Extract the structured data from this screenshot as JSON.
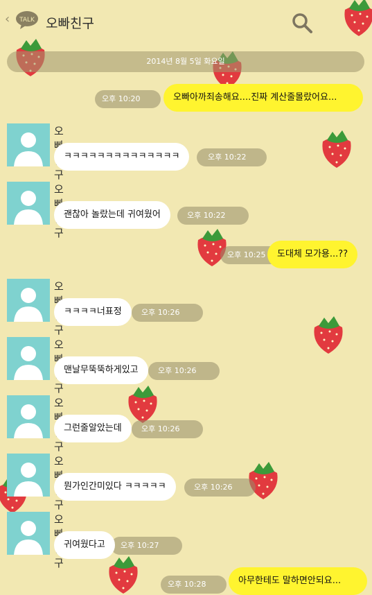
{
  "header": {
    "back_label": "‹",
    "logo_text": "TALK",
    "title": "오빠친구",
    "search_icon": "search-icon",
    "menu_icon": "more-icon"
  },
  "date_divider": "2014년 8월 5일 화요일",
  "messages": [
    {
      "dir": "out",
      "text": "오빠아까죄송해요....진짜 계산줄몰랐어요...",
      "time": "오후 10:20"
    },
    {
      "dir": "in",
      "sender": "오빠친구",
      "text": "ㅋㅋㅋㅋㅋㅋㅋㅋㅋㅋㅋㅋㅋㅋ",
      "time": "오후 10:22"
    },
    {
      "dir": "in",
      "sender": "오빠친구",
      "text": "괜찮아 놀랐는데 귀여웠어",
      "time": "오후 10:22"
    },
    {
      "dir": "out",
      "text": "도대체 모가용...??",
      "time": "오후 10:25"
    },
    {
      "dir": "in",
      "sender": "오빠친구",
      "text": "ㅋㅋㅋㅋ너표정",
      "time": "오후 10:26"
    },
    {
      "dir": "in",
      "sender": "오빠친구",
      "text": "맨날무뚝뚝하게있고",
      "time": "오후 10:26"
    },
    {
      "dir": "in",
      "sender": "오빠친구",
      "text": "그런줄알았는데",
      "time": "오후 10:26"
    },
    {
      "dir": "in",
      "sender": "오빠친구",
      "text": "뭔가인간미있다 ㅋㅋㅋㅋㅋ",
      "time": "오후 10:26"
    },
    {
      "dir": "in",
      "sender": "오빠친구",
      "text": "귀여웠다고",
      "time": "오후 10:27"
    },
    {
      "dir": "out",
      "text": "아무한테도 말하면안되요...",
      "time": "오후 10:28"
    }
  ],
  "colors": {
    "background": "#f2e8b2",
    "out_bubble": "#fff42f",
    "in_bubble": "#ffffff",
    "avatar": "#7fd2cf",
    "strawberry": "#e23a3f"
  }
}
